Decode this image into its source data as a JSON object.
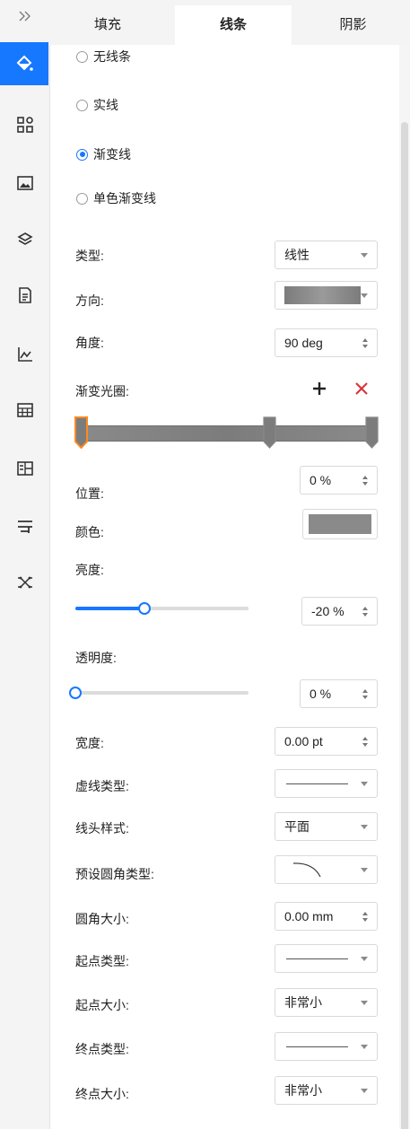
{
  "sidebar": {
    "collapse_icon": "chevron-double-right-icon",
    "items": [
      {
        "icon": "paint-bucket-icon",
        "active": true
      },
      {
        "icon": "shapes-grid-icon"
      },
      {
        "icon": "image-icon"
      },
      {
        "icon": "layers-icon"
      },
      {
        "icon": "document-icon"
      },
      {
        "icon": "chart-icon"
      },
      {
        "icon": "table-icon"
      },
      {
        "icon": "page-layout-icon"
      },
      {
        "icon": "presentation-icon"
      },
      {
        "icon": "shuffle-icon"
      }
    ]
  },
  "tabs": [
    {
      "label": "填充"
    },
    {
      "label": "线条",
      "active": true
    },
    {
      "label": "阴影"
    }
  ],
  "line_options": [
    {
      "label": "无线条",
      "selected": false
    },
    {
      "label": "实线",
      "selected": false
    },
    {
      "label": "渐变线",
      "selected": true
    },
    {
      "label": "单色渐变线",
      "selected": false
    }
  ],
  "props": {
    "type": {
      "label": "类型:",
      "value": "线性"
    },
    "direction": {
      "label": "方向:"
    },
    "angle": {
      "label": "角度:",
      "value": "90 deg"
    },
    "gradient_stops": {
      "label": "渐变光圈:"
    },
    "position": {
      "label": "位置:",
      "value": "0 %"
    },
    "color": {
      "label": "颜色:",
      "swatch": "#8a8a8a"
    },
    "brightness": {
      "label": "亮度:",
      "value": "-20 %",
      "slider_fraction": 0.4
    },
    "transparency": {
      "label": "透明度:",
      "value": "0 %",
      "slider_fraction": 0.0
    },
    "width": {
      "label": "宽度:",
      "value": "0.00 pt"
    },
    "dash_type": {
      "label": "虚线类型:"
    },
    "cap_style": {
      "label": "线头样式:",
      "value": "平面"
    },
    "corner_preset": {
      "label": "预设圆角类型:"
    },
    "corner_size": {
      "label": "圆角大小:",
      "value": "0.00 mm"
    },
    "start_type": {
      "label": "起点类型:"
    },
    "start_size": {
      "label": "起点大小:",
      "value": "非常小"
    },
    "end_type": {
      "label": "终点类型:"
    },
    "end_size": {
      "label": "终点大小:",
      "value": "非常小"
    }
  },
  "gradient": {
    "stops": [
      0,
      0.65,
      1.0
    ],
    "selected_stop": 0,
    "stop_color": "#7c7c7c"
  },
  "colors": {
    "accent": "#1677ff",
    "delete": "#d9363e"
  }
}
